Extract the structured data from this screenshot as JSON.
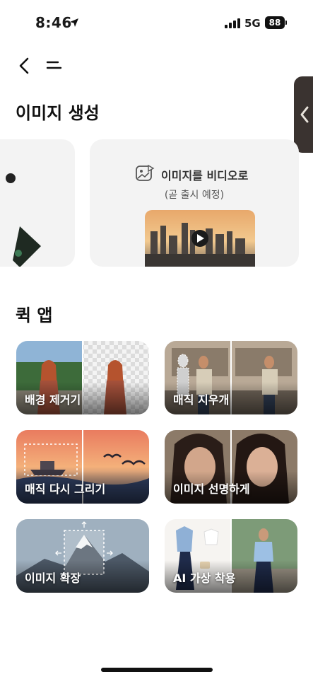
{
  "status": {
    "time": "8:46",
    "network": "5G",
    "battery": "88"
  },
  "sections": {
    "generation_title": "이미지 생성",
    "quick_apps_title": "퀵 앱"
  },
  "image_to_video": {
    "title": "이미지를 비디오로",
    "subtitle": "(곧 출시 예정)"
  },
  "quick_apps": [
    {
      "label": "배경 제거기"
    },
    {
      "label": "매직 지우개"
    },
    {
      "label": "매직 다시 그리기"
    },
    {
      "label": "이미지 선명하게"
    },
    {
      "label": "이미지 확장"
    },
    {
      "label": "AI 가상 착용"
    }
  ],
  "icons": {
    "back": "chevron-left-icon",
    "menu": "menu-icon",
    "side_handle": "chevron-left-icon",
    "location": "location-arrow-icon",
    "image_video": "image-video-icon",
    "play": "play-icon"
  }
}
